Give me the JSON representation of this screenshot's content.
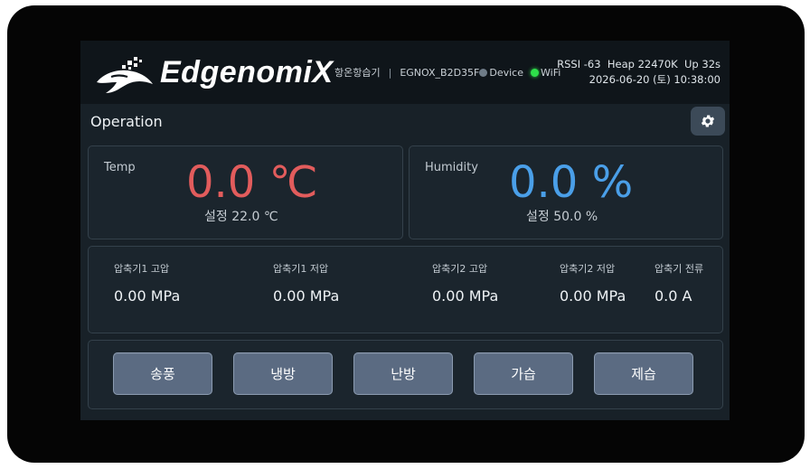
{
  "brand": {
    "name": "EdgenomiX"
  },
  "header": {
    "device_name": "항온항습기",
    "device_id": "EGNOX_B2D35F",
    "device_label": "Device",
    "wifi_label": "WiFi",
    "status_line1": "RSSI -63  Heap 22470K  Up 32s",
    "status_line2": "2026-06-20 (토) 10:38:00"
  },
  "section": {
    "title": "Operation"
  },
  "temp": {
    "label": "Temp",
    "value": "0.0 ℃",
    "setpoint": "설정 22.0 ℃",
    "color": "#e25c5c"
  },
  "humidity": {
    "label": "Humidity",
    "value": "0.0 %",
    "setpoint": "설정 50.0 %",
    "color": "#4a9fe8"
  },
  "pressures": [
    {
      "label": "압축기1 고압",
      "value": "0.00 MPa"
    },
    {
      "label": "압축기1 저압",
      "value": "0.00 MPa"
    },
    {
      "label": "압축기2 고압",
      "value": "0.00 MPa"
    },
    {
      "label": "압축기2 저압",
      "value": "0.00 MPa"
    },
    {
      "label": "압축기 전류",
      "value": "0.0 A"
    }
  ],
  "modes": [
    {
      "label": "송풍"
    },
    {
      "label": "냉방"
    },
    {
      "label": "난방"
    },
    {
      "label": "가습"
    },
    {
      "label": "제습"
    }
  ],
  "icons": {
    "settings": "gear-icon",
    "wifi_status": "status-dot-green",
    "device_status": "status-dot-gray"
  },
  "colors": {
    "wifi_ok": "#2ee04a",
    "button": "#5b6b82",
    "background": "#182128"
  }
}
